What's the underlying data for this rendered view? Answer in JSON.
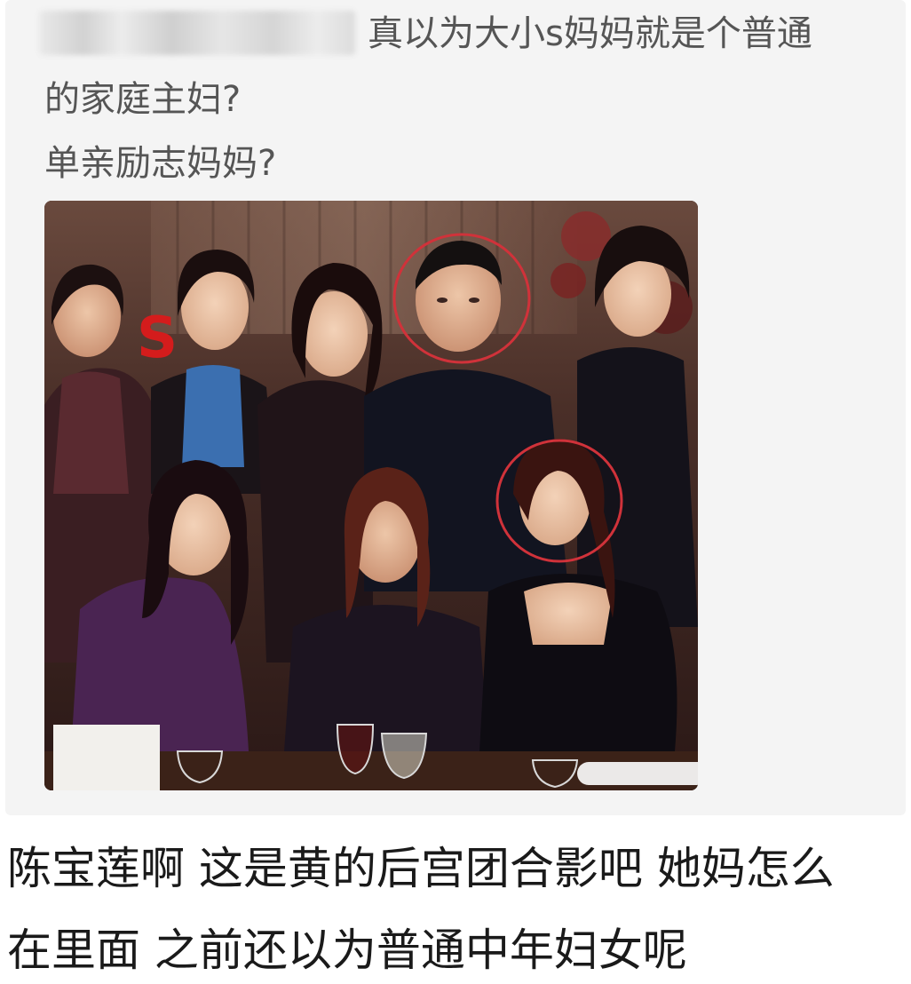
{
  "quote": {
    "line1": "真以为大小s妈妈就是个普通",
    "line2": "的家庭主妇?",
    "line3": "单亲励志妈妈?"
  },
  "photo": {
    "annotation_mark": "S",
    "colors": {
      "circle_stroke": "#d0323a",
      "mark_color": "#d41c1c"
    }
  },
  "reply": {
    "line1": "陈宝莲啊 这是黄的后宫团合影吧 她妈怎么",
    "line2": "在里面 之前还以为普通中年妇女呢"
  }
}
